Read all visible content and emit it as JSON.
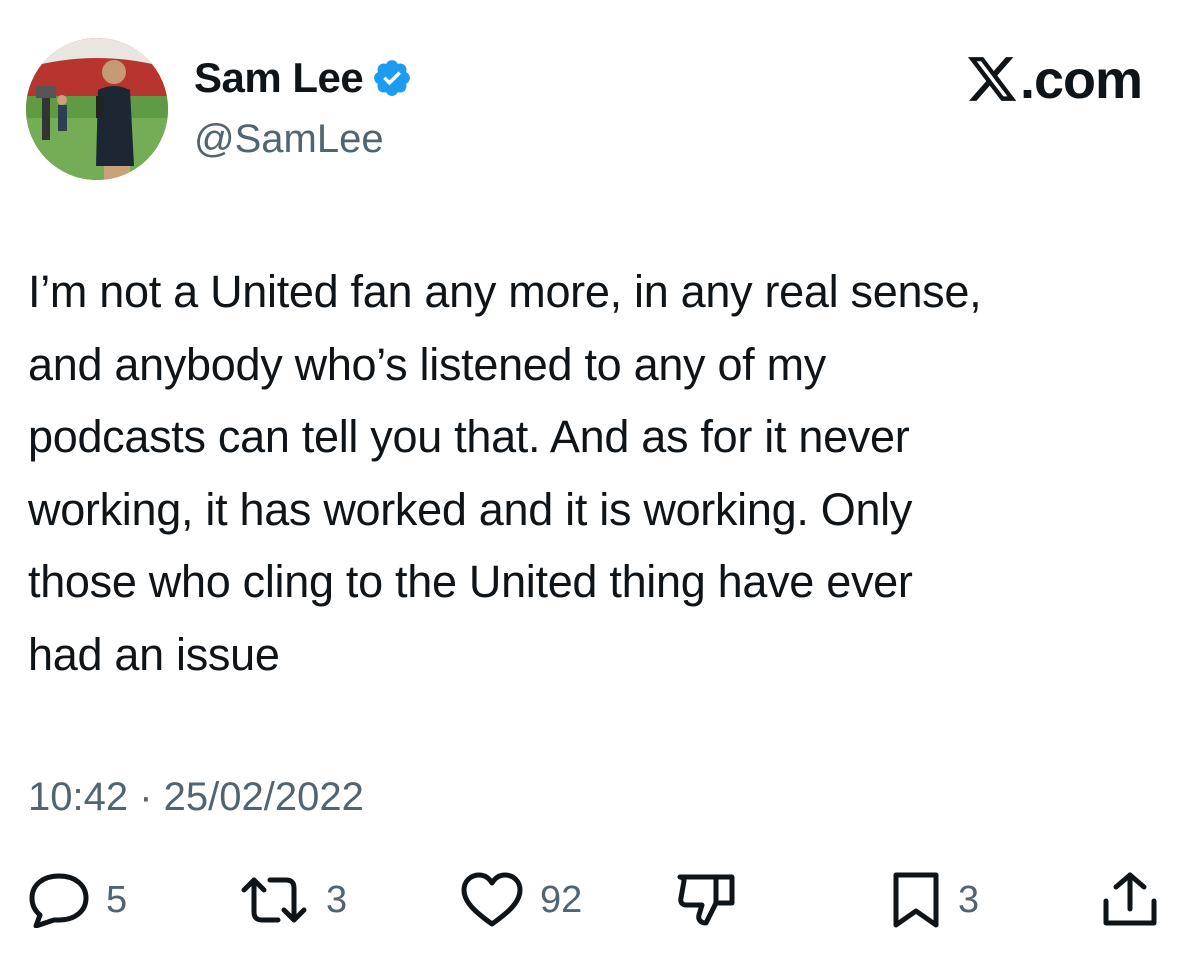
{
  "user": {
    "display_name": "Sam Lee",
    "handle": "@SamLee",
    "verified": true,
    "verified_color": "#1d9bf0"
  },
  "brand": {
    "label": ".com"
  },
  "tweet": {
    "lines": [
      "I’m not a United fan any more, in any real sense,",
      "and anybody who’s listened to any of my",
      "podcasts can tell you that. And as for it never",
      "working, it has worked and it is working. Only",
      "those who cling to the United thing have ever",
      "had an issue"
    ],
    "timestamp": "10:42 · 25/02/2022"
  },
  "actions": {
    "replies": {
      "icon": "reply-icon",
      "count": "5"
    },
    "retweets": {
      "icon": "retweet-icon",
      "count": "3"
    },
    "likes": {
      "icon": "heart-icon",
      "count": "92"
    },
    "dislike": {
      "icon": "thumbs-down-icon"
    },
    "bookmarks": {
      "icon": "bookmark-icon",
      "count": "3"
    },
    "share": {
      "icon": "share-icon"
    }
  }
}
